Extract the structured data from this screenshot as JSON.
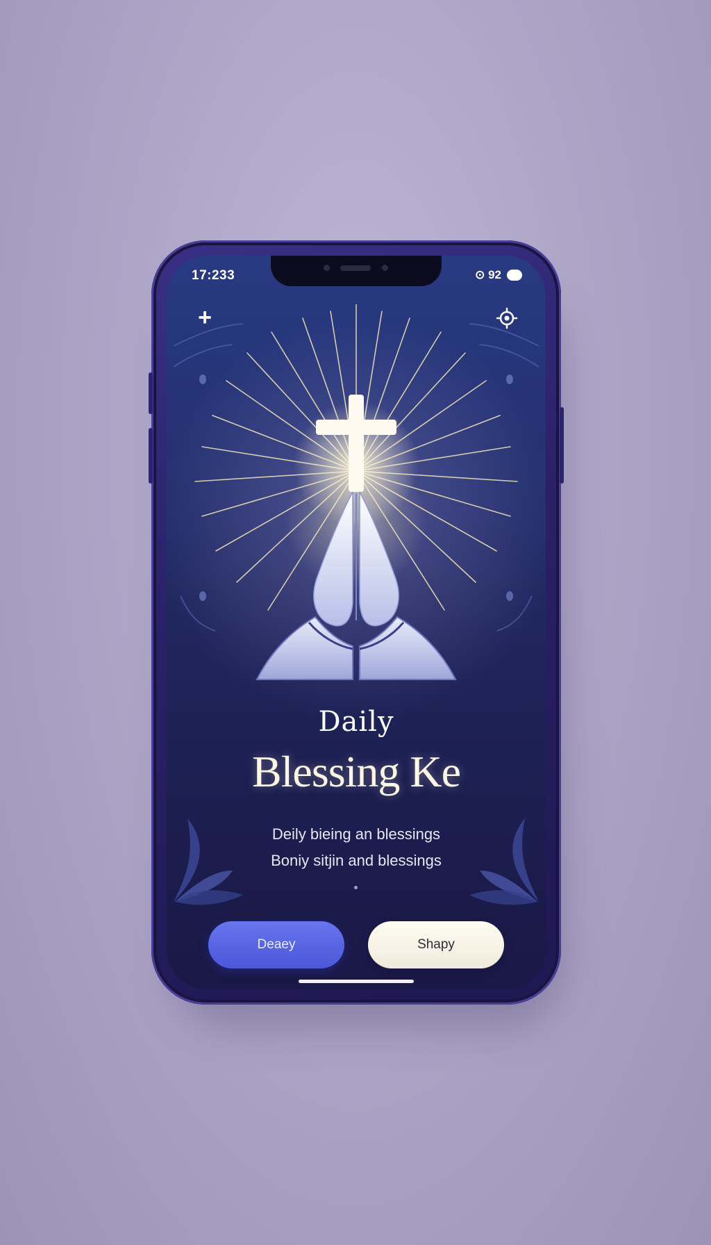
{
  "status_bar": {
    "time": "17:233",
    "right_text": "⊙ 92",
    "battery_icon": "battery-icon"
  },
  "top_bar": {
    "left_icon": "plus-icon",
    "right_icon": "settings-icon"
  },
  "hero": {
    "icons": [
      "cross-icon",
      "praying-hands-icon",
      "light-rays"
    ]
  },
  "title": {
    "line1": "Daily",
    "line2": "Blessing Ke"
  },
  "subtitle": {
    "line1": "Deily bieing an blessings",
    "line2": "Boniy sitjin and blessings"
  },
  "buttons": {
    "primary_label": "Deaey",
    "secondary_label": "Shapy"
  },
  "colors": {
    "background": "#aea6c7",
    "phone_frame": "#2a2066",
    "screen_top": "#283a82",
    "screen_bottom": "#1a1846",
    "primary_button": "#5a66e4",
    "secondary_button": "#f7f3e6",
    "title_text": "#fbf6e6"
  }
}
